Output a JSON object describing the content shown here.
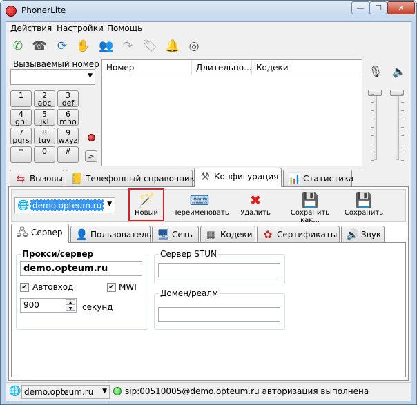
{
  "window": {
    "title": "PhonerLite",
    "min_glyph": "—",
    "max_glyph": "☐",
    "close_glyph": "✕"
  },
  "menu": {
    "items": [
      {
        "label": "Действия"
      },
      {
        "label": "Настройки"
      },
      {
        "label": "Помощь"
      }
    ]
  },
  "toolbar": {
    "icons": [
      "phone-pickup-icon",
      "phone-hangup-icon",
      "redial-icon",
      "hold-hand-icon",
      "conference-icon",
      "forward-icon",
      "dtmf-tag-icon",
      "bell-icon",
      "mute-mask-icon"
    ]
  },
  "dialer": {
    "label": "Вызываемый номер",
    "value": "",
    "keys": [
      {
        "digit": "1",
        "letters": ""
      },
      {
        "digit": "2",
        "letters": "abc"
      },
      {
        "digit": "3",
        "letters": "def"
      },
      {
        "digit": "4",
        "letters": "ghi"
      },
      {
        "digit": "5",
        "letters": "jkl"
      },
      {
        "digit": "6",
        "letters": "mno"
      },
      {
        "digit": "7",
        "letters": "pqrs"
      },
      {
        "digit": "8",
        "letters": "tuv"
      },
      {
        "digit": "9",
        "letters": "wxyz"
      },
      {
        "digit": "*",
        "letters": ""
      },
      {
        "digit": "0",
        "letters": ""
      },
      {
        "digit": "#",
        "letters": ""
      }
    ],
    "more_button": ">"
  },
  "calls_table": {
    "columns": [
      "Номер",
      "Длительно...",
      "Кодеки"
    ],
    "rows": []
  },
  "main_tabs": [
    {
      "label": "Вызовы",
      "active": false
    },
    {
      "label": "Телефонный справочник",
      "active": false
    },
    {
      "label": "Конфигурация",
      "active": true
    },
    {
      "label": "Статистика",
      "active": false
    }
  ],
  "config": {
    "account_selected": "demo.opteum.ru",
    "actions": [
      {
        "label": "Новый",
        "highlighted": true
      },
      {
        "label": "Переименовать"
      },
      {
        "label": "Удалить"
      },
      {
        "label": "Сохранить как..."
      },
      {
        "label": "Сохранить"
      }
    ],
    "sub_tabs": [
      {
        "label": "Сервер",
        "active": true
      },
      {
        "label": "Пользователь",
        "active": false
      },
      {
        "label": "Сеть",
        "active": false
      },
      {
        "label": "Кодеки",
        "active": false
      },
      {
        "label": "Сертификаты",
        "active": false
      },
      {
        "label": "Звук",
        "active": false
      }
    ],
    "server": {
      "proxy_label": "Прокси/сервер авторизации",
      "proxy_value": "demo.opteum.ru",
      "autologin_label": "Автовход",
      "autologin_checked": true,
      "mwi_label": "MWI",
      "mwi_checked": true,
      "interval_value": "900",
      "interval_unit": "секунд",
      "stun_label": "Сервер STUN",
      "stun_value": "",
      "realm_label": "Домен/реалм",
      "realm_value": ""
    }
  },
  "status": {
    "account": "demo.opteum.ru",
    "message": "sip:00510005@demo.opteum.ru авторизация выполнена",
    "status_color": "#2fbf2f"
  },
  "colors": {
    "highlight": "#e02020",
    "selection": "#3399ff"
  }
}
